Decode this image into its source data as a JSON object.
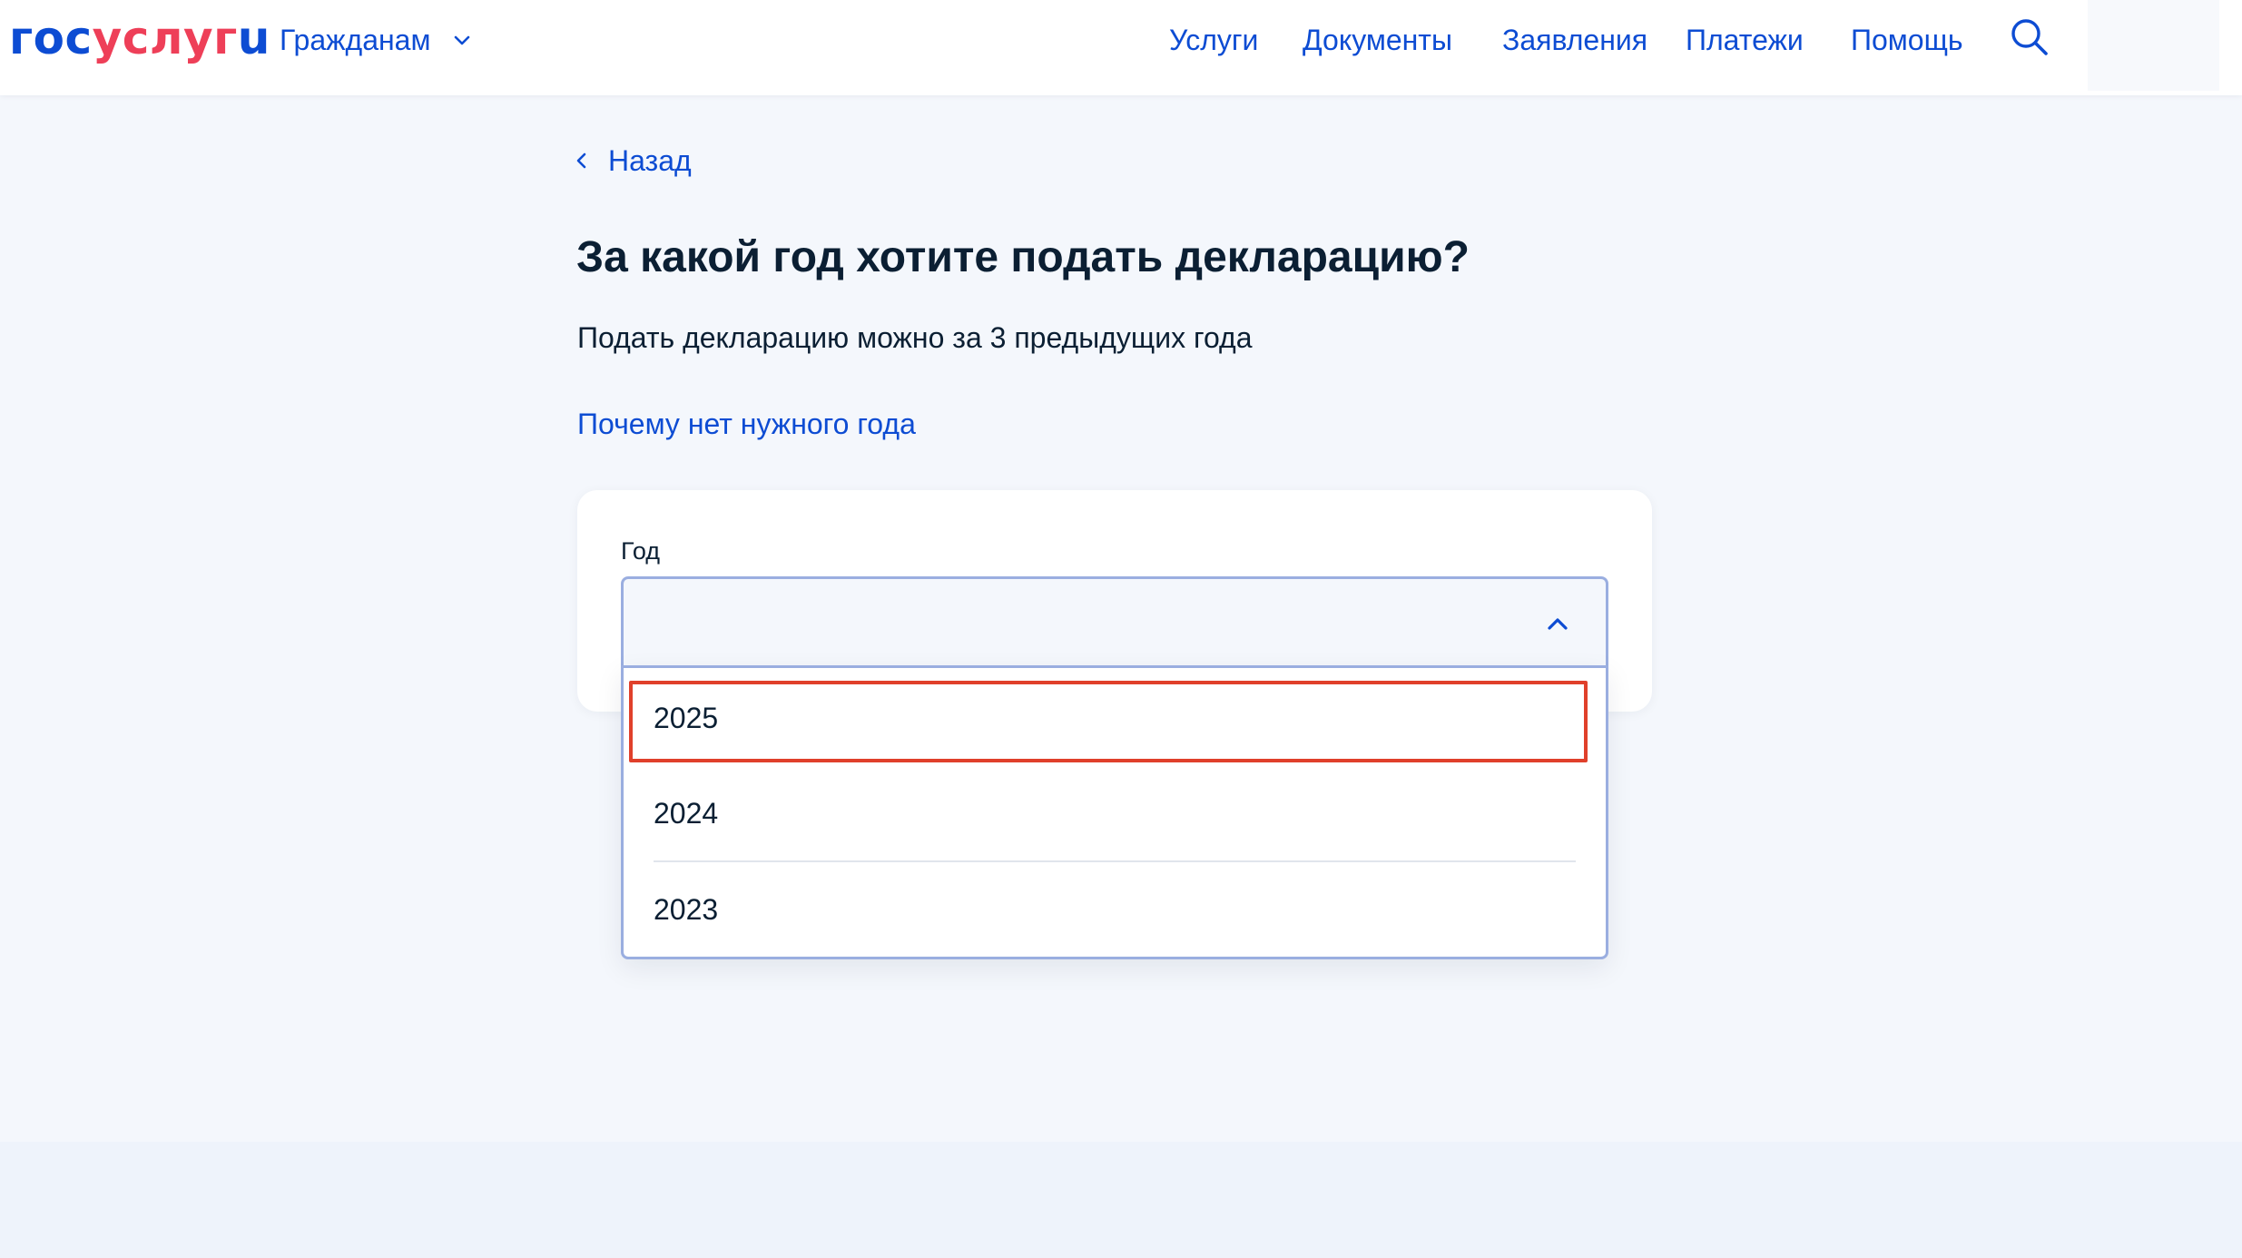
{
  "header": {
    "logo_part1": "гос",
    "logo_part2": "услуг",
    "logo_part3": "u",
    "citizens_label": "Гражданам",
    "nav": {
      "services": "Услуги",
      "documents": "Документы",
      "applications": "Заявления",
      "payments": "Платежи",
      "help": "Помощь"
    },
    "icons": {
      "citizens_chevron": "chevron-down-icon",
      "search": "search-icon"
    }
  },
  "main": {
    "back_label": "Назад",
    "title": "За какой год хотите подать декларацию?",
    "subtitle": "Подать декларацию можно за 3 предыдущих года",
    "why_link": "Почему нет нужного года",
    "year_field": {
      "label": "Год",
      "value": "",
      "expanded": true,
      "options": [
        "2025",
        "2024",
        "2023"
      ],
      "highlighted_option": "2025"
    }
  },
  "colors": {
    "brand_blue": "#0d4cd3",
    "brand_red": "#ee3f58",
    "text": "#0b1f33",
    "page_bg": "#f4f7fc",
    "field_border": "#9aaee0",
    "highlight_border": "#e0402b"
  }
}
